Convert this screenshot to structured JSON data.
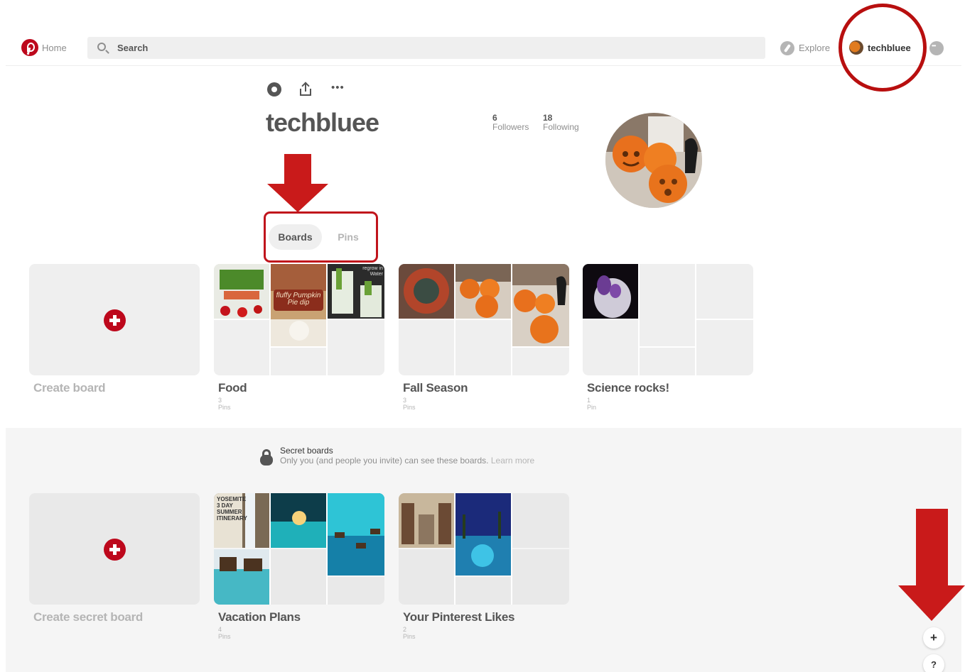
{
  "topbar": {
    "home_label": "Home",
    "search_placeholder": "Search",
    "explore_label": "Explore",
    "username": "techbluee"
  },
  "profile": {
    "name": "techbluee",
    "followers_count": "6",
    "followers_label": "Followers",
    "following_count": "18",
    "following_label": "Following"
  },
  "tabs": {
    "boards_label": "Boards",
    "pins_label": "Pins",
    "active": "Boards"
  },
  "boards": {
    "create_label": "Create board",
    "items": [
      {
        "title": "Food",
        "count": "3 Pins"
      },
      {
        "title": "Fall Season",
        "count": "3 Pins"
      },
      {
        "title": "Science rocks!",
        "count": "1 Pin"
      }
    ]
  },
  "secret": {
    "title": "Secret boards",
    "description": "Only you (and people you invite) can see these boards.",
    "learn_more": "Learn more",
    "create_label": "Create secret board",
    "items": [
      {
        "title": "Vacation Plans",
        "count": "4 Pins"
      },
      {
        "title": "Your Pinterest Likes",
        "count": "2 Pins"
      }
    ]
  },
  "floating": {
    "add_label": "+",
    "help_label": "?"
  },
  "image_text": {
    "pumpkin_pie_card": "fluffy Pumpkin Pie dip",
    "yosemite_card": "YOSEMITE 3 DAY SUMMER ITINERARY",
    "regrow_card": "regrow in Water"
  },
  "colors": {
    "brand_red": "#bd081c",
    "annotation_red": "#c91a1a",
    "text_dark": "#555555",
    "text_muted": "#b5b5b5",
    "cover_bg": "#efefef",
    "secret_bg": "#f5f5f5"
  },
  "icons": [
    "pinterest-logo-icon",
    "search-icon",
    "explore-compass-icon",
    "chat-icon",
    "settings-hex-icon",
    "share-icon",
    "more-icon",
    "lock-icon",
    "plus-icon",
    "help-icon",
    "down-arrow-annotation"
  ]
}
